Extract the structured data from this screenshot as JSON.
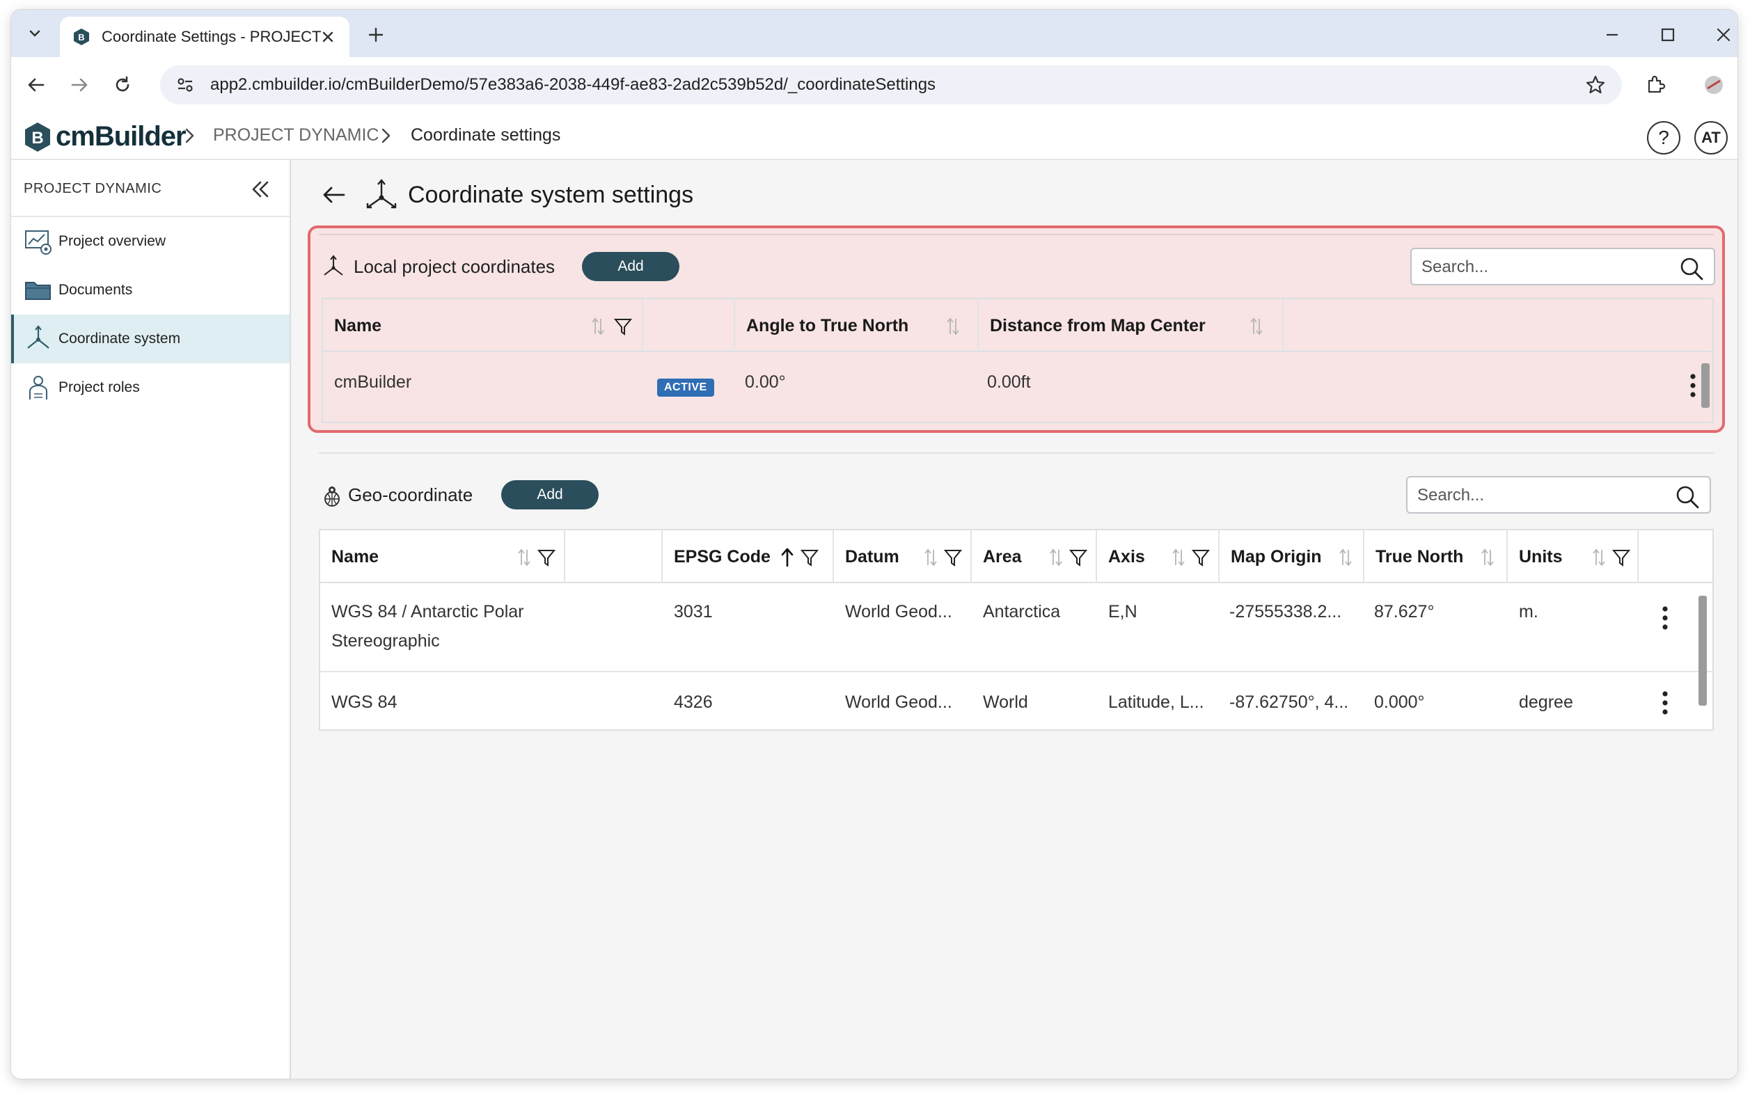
{
  "browser": {
    "tab_title": "Coordinate Settings - PROJECT",
    "url": "app2.cmbuilder.io/cmBuilderDemo/57e383a6-2038-449f-ae83-2ad2c539b52d/_coordinateSettings"
  },
  "app": {
    "logo_text": "cmBuilder",
    "breadcrumb": [
      "PROJECT DYNAMIC",
      "Coordinate settings"
    ],
    "help_label": "?",
    "avatar_initials": "AT"
  },
  "sidebar": {
    "title": "PROJECT DYNAMIC",
    "items": [
      {
        "label": "Project overview",
        "icon": "project-overview-icon"
      },
      {
        "label": "Documents",
        "icon": "folder-icon"
      },
      {
        "label": "Coordinate system",
        "icon": "coordinate-axes-icon",
        "active": true
      },
      {
        "label": "Project roles",
        "icon": "person-roles-icon"
      }
    ]
  },
  "page": {
    "title": "Coordinate system settings"
  },
  "local": {
    "label": "Local project coordinates",
    "add_label": "Add",
    "search_placeholder": "Search...",
    "columns": [
      "Name",
      "Angle to True North",
      "Distance from Map Center"
    ],
    "rows": [
      {
        "name": "cmBuilder",
        "status": "ACTIVE",
        "angle": "0.00°",
        "distance": "0.00ft"
      }
    ]
  },
  "geo": {
    "label": "Geo-coordinate",
    "add_label": "Add",
    "search_placeholder": "Search...",
    "columns": [
      "Name",
      "EPSG Code",
      "Datum",
      "Area",
      "Axis",
      "Map Origin",
      "True North",
      "Units"
    ],
    "rows": [
      {
        "name_line1": "WGS 84 / Antarctic Polar",
        "name_line2": "Stereographic",
        "epsg": "3031",
        "datum": "World Geod...",
        "area": "Antarctica",
        "axis": "E,N",
        "origin": "-27555338.2...",
        "north": "87.627°",
        "units": "m."
      },
      {
        "name_line1": "WGS 84",
        "name_line2": "",
        "epsg": "4326",
        "datum": "World Geod...",
        "area": "World",
        "axis": "Latitude, L...",
        "origin": "-87.62750°, 4...",
        "north": "0.000°",
        "units": "degree"
      }
    ]
  },
  "colors": {
    "accent": "#2a4e5b",
    "highlight_border": "#e36a6f",
    "highlight_fill": "#f8e4e4",
    "badge": "#2f6db5"
  }
}
